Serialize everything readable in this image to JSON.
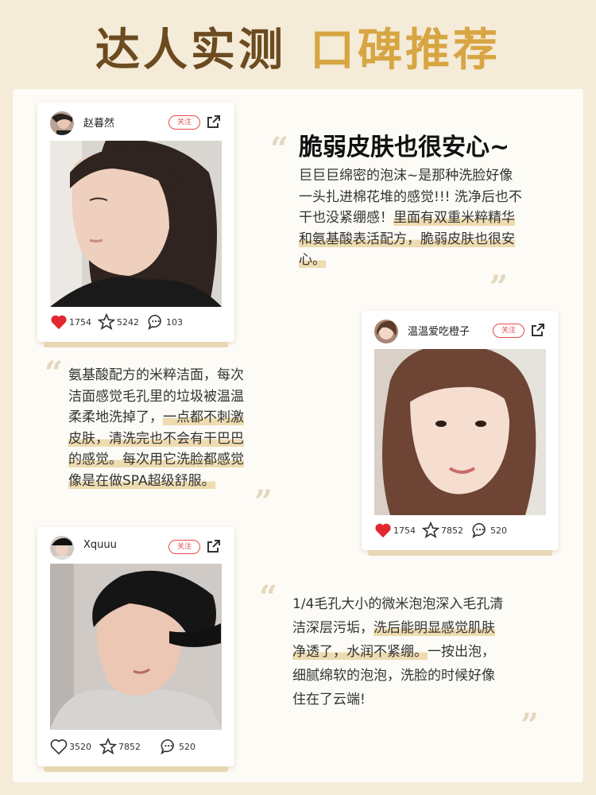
{
  "header": {
    "title_main": "达人实测",
    "title_accent": "口碑推荐"
  },
  "follow_label": "关注",
  "cards": [
    {
      "username": "赵暮然",
      "likes": "1754",
      "stars": "5242",
      "comments": "103"
    },
    {
      "username": "温温爱吃橙子",
      "likes": "1754",
      "stars": "7852",
      "comments": "520"
    },
    {
      "username": "Xquuu",
      "likes": "3520",
      "stars": "7852",
      "comments": "520"
    }
  ],
  "reviews": [
    {
      "title": "脆弱皮肤也很安心~",
      "lines_plain": [
        "巨巨巨绵密的泡沫~是那种洗脸好像",
        "一头扎进棉花堆的感觉!!! 洗净后也不",
        "干也没紧绷感！"
      ],
      "lines_hl": [
        "里面有双重米粹精华",
        "和氨基酸表活配方，脆弱皮肤也很安",
        "心。"
      ]
    },
    {
      "lines": [
        "氨基酸配方的米粹洁面，每次",
        "洁面感觉毛孔里的垃圾被温温",
        "柔柔地洗掉了，",
        "一点都不刺激",
        "皮肤，清洗完也不会有干巴巴",
        "的感觉。每次用它洗脸都感觉",
        "像是在做SPA超级舒服。"
      ]
    },
    {
      "lines": [
        "1/4毛孔大小的微米泡泡深入毛孔清",
        "洁深层污垢，",
        "洗后能明显感觉肌肤",
        "净透了，水润不紧绷。",
        "一按出泡，",
        "细腻绵软的泡泡，洗脸的时候好像",
        "住在了云端!"
      ]
    }
  ],
  "colors": {
    "brown": "#6b4b1f",
    "gold": "#d7a542",
    "red": "#e44b4b",
    "highlight": "#eedcb0"
  },
  "icons": [
    "heart-icon",
    "star-icon",
    "comment-icon",
    "share-icon",
    "quote-open-icon",
    "quote-close-icon"
  ]
}
